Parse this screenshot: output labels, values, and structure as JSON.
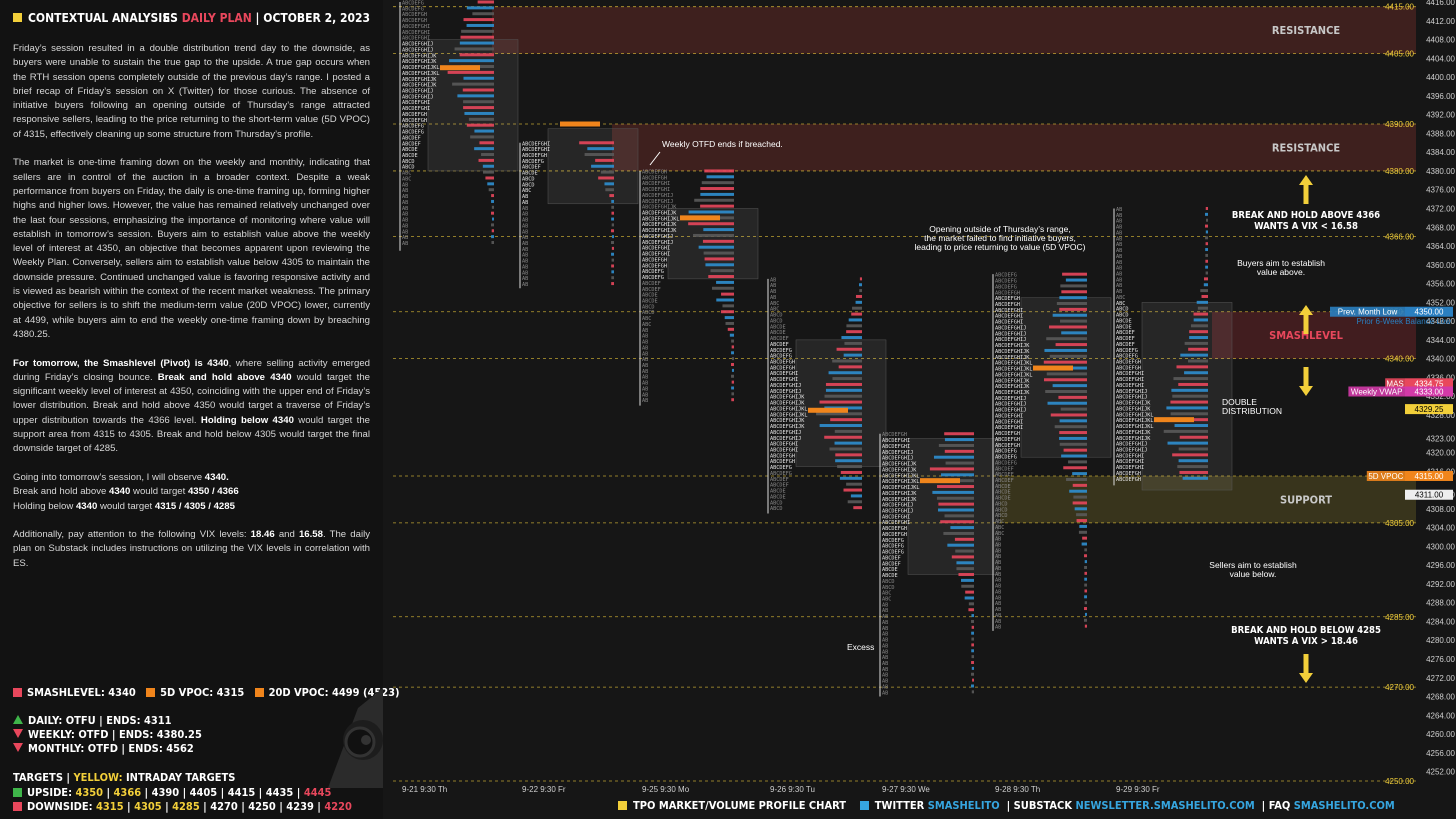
{
  "header": {
    "left_title": "CONTEXTUAL ANALYSIS",
    "symbol": "ES",
    "plan": "DAILY PLAN",
    "date": "OCTOBER 2, 2023"
  },
  "paragraphs": [
    "Friday’s session resulted in a double distribution trend day to the downside, as buyers were unable to sustain the true gap to the upside. A true gap occurs when the RTH session opens completely outside of the previous day’s range. I posted a brief recap of Friday’s session on X (Twitter) for those curious. The absence of initiative buyers following an opening outside of Thursday’s range attracted responsive sellers, leading to the price returning to the short-term value (5D VPOC) of 4315, effectively cleaning up some structure from Thursday’s profile.",
    "The market is one-time framing down on the weekly and monthly, indicating that sellers are in control of the auction in a broader context. Despite a weak performance from buyers on Friday, the daily is one-time framing up, forming higher highs and higher lows. However, the value has remained relatively unchanged over the last four sessions, emphasizing the importance of monitoring where value will establish in tomorrow’s session. Buyers aim to establish value above the weekly level of interest at 4350, an objective that becomes apparent upon reviewing the Weekly Plan. Conversely, sellers aim to establish value below 4305 to maintain the downside pressure. Continued unchanged value is favoring responsive activity and is viewed as bearish within the context of the recent market weakness. The primary objective for sellers is to shift the medium-term value (20D VPOC) lower, currently at 4499, while buyers aim to end the weekly one-time framing down by breaching 4380.25."
  ],
  "para3": [
    {
      "t": "For tomorrow, the Smashlevel (Pivot) is 4340",
      "b": true
    },
    {
      "t": ", where selling activity emerged during Friday’s closing bounce. ",
      "b": false
    },
    {
      "t": "Break and hold above 4340",
      "b": true
    },
    {
      "t": " would target the significant weekly level of interest at 4350, coinciding with the upper end of Friday’s lower distribution. Break and hold above 4350 would target a traverse of Friday’s upper distribution towards the 4366 level. ",
      "b": false
    },
    {
      "t": "Holding below 4340",
      "b": true
    },
    {
      "t": " would target the support area from 4315 to 4305. Break and hold below 4305 would target the final downside target of 4285.",
      "b": false
    }
  ],
  "para4": [
    [
      {
        "t": "Going into tomorrow’s session, I will observe ",
        "b": false
      },
      {
        "t": "4340.",
        "b": true
      }
    ],
    [
      {
        "t": "Break and hold above ",
        "b": false
      },
      {
        "t": "4340",
        "b": true
      },
      {
        "t": " would target ",
        "b": false
      },
      {
        "t": "4350 / 4366",
        "b": true
      }
    ],
    [
      {
        "t": "Holding below ",
        "b": false
      },
      {
        "t": "4340",
        "b": true
      },
      {
        "t": " would target ",
        "b": false
      },
      {
        "t": "4315 / 4305 / 4285",
        "b": true
      }
    ]
  ],
  "para5": [
    {
      "t": "Additionally, pay attention to the following VIX levels: ",
      "b": false
    },
    {
      "t": "18.46",
      "b": true
    },
    {
      "t": " and ",
      "b": false
    },
    {
      "t": "16.58",
      "b": true
    },
    {
      "t": ". The daily plan on Substack includes instructions on utilizing the VIX levels in correlation with ES.",
      "b": false
    }
  ],
  "key_levels": {
    "smashlevel": "SMASHLEVEL: 4340",
    "vpoc5": "5D VPOC: 4315",
    "vpoc20": "20D VPOC: 4499 (4523)",
    "daily": "DAILY: OTFU  |  ENDS: 4311",
    "weekly": "WEEKLY: OTFD  |  ENDS: 4380.25",
    "monthly": "MONTHLY: OTFD  |  ENDS: 4562",
    "targets_label": "TARGETS  |  ",
    "targets_yellow": "YELLOW:",
    "targets_tail": " INTRADAY TARGETS",
    "upside_label": "UPSIDE: ",
    "upside_yellow": [
      "4350",
      "4366"
    ],
    "upside_white": "4390  |  4405  |  4415  |  4435",
    "upside_red": "4445",
    "downside_label": "DOWNSIDE: ",
    "downside_yellow": [
      "4315",
      "4305",
      "4285"
    ],
    "downside_white": "4270  |  4250  |  4239",
    "downside_red": "4220"
  },
  "colors": {
    "red": "#e8475c",
    "yellow": "#f2cf3a",
    "green": "#3fb54a",
    "orange": "#f0851c",
    "blue": "#36a6e0"
  },
  "footer": {
    "chart_label": "TPO MARKET/VOLUME PROFILE CHART",
    "twitter": "TWITTER",
    "twitter_handle": "SMASHELITO",
    "substack": "SUBSTACK",
    "substack_url": "NEWSLETTER.SMASHELITO.COM",
    "faq": "FAQ",
    "faq_url": "SMASHELITO.COM",
    "sep": "|"
  },
  "chart_data": {
    "type": "market profile",
    "title": "",
    "ylim": [
      4250,
      4416
    ],
    "price_ticks": [
      4416,
      4412,
      4408,
      4404,
      4400,
      4396,
      4392,
      4388,
      4384,
      4380,
      4376,
      4372,
      4368,
      4364,
      4360,
      4356,
      4352,
      4348,
      4344,
      4340,
      4336,
      4332,
      4328,
      4323,
      4320,
      4316,
      4311,
      4308,
      4304,
      4300,
      4296,
      4292,
      4288,
      4284,
      4280,
      4276,
      4272,
      4268,
      4264,
      4260,
      4256,
      4252
    ],
    "level_lines": [
      4415,
      4405,
      4390,
      4380,
      4366,
      4350,
      4340,
      4315,
      4305,
      4285,
      4270,
      4250
    ],
    "level_labels": [
      "4415.00",
      "4405.00",
      "4390.00",
      "4380.00",
      "4366.00",
      "4350.00",
      "4340.00",
      "4315.00",
      "4305.00",
      "4285.00",
      "4270.00",
      "4250.00"
    ],
    "x_labels": [
      "9-21  9:30 Th",
      "9-22  9:30 Fr",
      "9-25  9:30 Mo",
      "9-26  9:30 Tu",
      "9-27  9:30 We",
      "9-28  9:30 Th",
      "9-29  9:30 Fr"
    ],
    "sessions": [
      {
        "date": "9-21",
        "high": 4416,
        "low": 4363,
        "va_high": 4408,
        "va_low": 4380,
        "poc": 4402
      },
      {
        "date": "9-22",
        "high": 4386,
        "low": 4355,
        "va_high": 4389,
        "va_low": 4373,
        "poc": 4390
      },
      {
        "date": "9-25",
        "high": 4380,
        "low": 4330,
        "va_high": 4372,
        "va_low": 4357,
        "poc": 4370
      },
      {
        "date": "9-26",
        "high": 4357,
        "low": 4307,
        "va_high": 4344,
        "va_low": 4317,
        "poc": 4329
      },
      {
        "date": "9-27",
        "high": 4324,
        "low": 4268,
        "va_high": 4323,
        "va_low": 4294,
        "poc": 4314
      },
      {
        "date": "9-28",
        "high": 4358,
        "low": 4282,
        "va_high": 4353,
        "va_low": 4319,
        "poc": 4338
      },
      {
        "date": "9-29",
        "high": 4372,
        "low": 4313,
        "va_high": 4352,
        "va_low": 4312,
        "poc": 4327
      }
    ],
    "zones": [
      {
        "label": "RESISTANCE",
        "from": 4405,
        "to": 4415
      },
      {
        "label": "RESISTANCE",
        "from": 4380,
        "to": 4390
      },
      {
        "label": "SMASHLEVEL",
        "from": 4340,
        "to": 4350
      },
      {
        "label": "SUPPORT",
        "from": 4305,
        "to": 4315
      }
    ],
    "annotations": {
      "otfd": "Weekly OTFD ends if breached.",
      "opening": [
        "Opening outside of Thursday’s range,",
        "the market failed to find initiative buyers,",
        "leading to price returning to value (5D VPOC)"
      ],
      "break_above": [
        "BREAK AND HOLD ABOVE 4366",
        "WANTS A VIX < 16.58"
      ],
      "buyers": [
        "Buyers aim to establish",
        "value above."
      ],
      "double": [
        "DOUBLE",
        "DISTRIBUTION"
      ],
      "sellers": [
        "Sellers aim to establish",
        "value below."
      ],
      "break_below": [
        "BREAK AND HOLD BELOW 4285",
        "WANTS A VIX > 18.46"
      ],
      "excess": "Excess"
    },
    "tags": [
      {
        "label": "Prev. Month Low",
        "value": "4350.00"
      },
      {
        "label": "Prior 6-Week Balance Low",
        "value": ""
      },
      {
        "label": "MAS",
        "value": "4334.75"
      },
      {
        "label": "Weekly VWAP",
        "value": "4333.00"
      },
      {
        "label": "",
        "value": "4329.25"
      },
      {
        "label": "5D VPOC",
        "value": "4315.00"
      },
      {
        "label": "",
        "value": "4311.00"
      }
    ]
  }
}
